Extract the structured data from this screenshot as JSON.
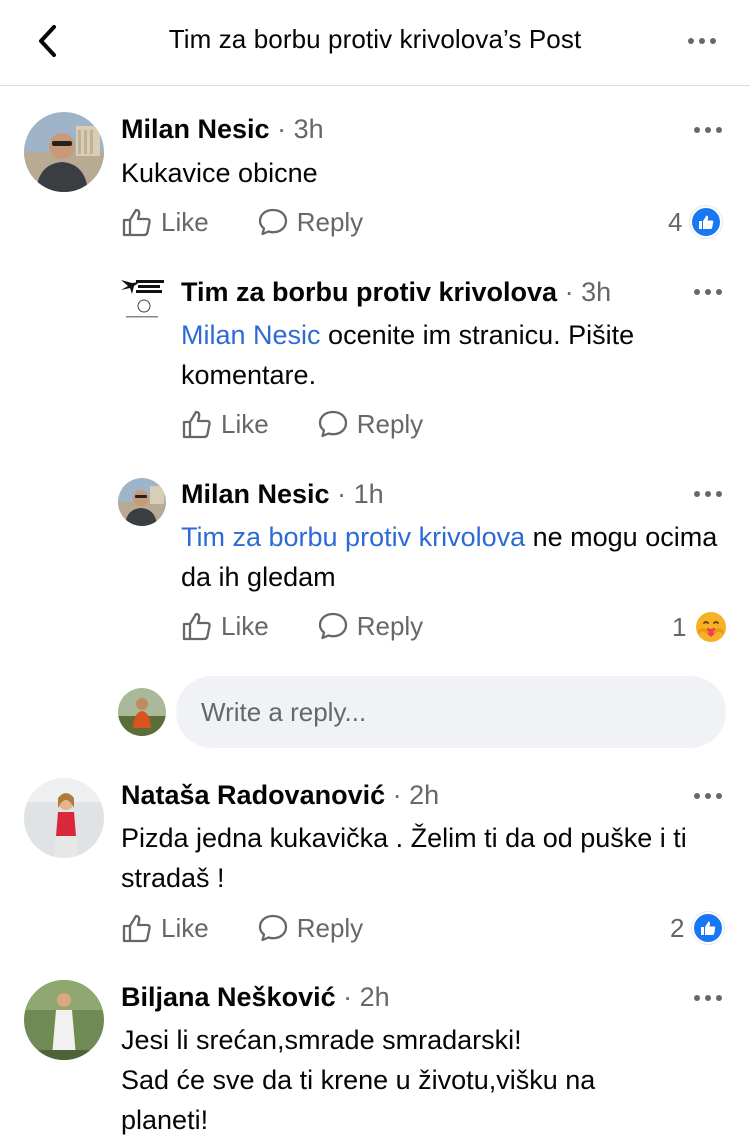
{
  "header": {
    "title": "Tim za borbu protiv krivolova’s Post",
    "back_icon": "chevron-left-icon",
    "more_icon": "more-horizontal-icon"
  },
  "labels": {
    "like": "Like",
    "reply": "Reply",
    "separator": "·"
  },
  "comments": [
    {
      "author": "Milan Nesic",
      "time": "3h",
      "text": "Kukavice obicne",
      "reaction_count": "4",
      "reaction_type": "like",
      "replies": [
        {
          "author": "Tim za borbu protiv krivolova",
          "time": "3h",
          "mention": "Milan Nesic",
          "text": " ocenite im stranicu. Pišite komentare.",
          "logo_text": "TIM ZA BORBU PROTIV KRIVOLOVA"
        },
        {
          "author": "Milan Nesic",
          "time": "1h",
          "mention": "Tim za borbu protiv krivolova",
          "text": " ne mogu ocima da ih gledam",
          "reaction_count": "1",
          "reaction_type": "care"
        }
      ],
      "reply_input": {
        "placeholder": "Write a reply..."
      }
    },
    {
      "author": "Nataša Radovanović",
      "time": "2h",
      "text": "Pizda jedna kukavička . Želim ti da od puške i ti stradaš !",
      "reaction_count": "2",
      "reaction_type": "like"
    },
    {
      "author": "Biljana Nešković",
      "time": "2h",
      "text_line1": "Jesi li srećan,smrade smradarski!",
      "text_line2": "Sad će sve da ti krene u životu,višku na planeti!"
    }
  ],
  "colors": {
    "link": "#2d6ad8",
    "secondary_text": "#65676b",
    "like_blue": "#1877f2",
    "input_bg": "#f0f2f5"
  }
}
